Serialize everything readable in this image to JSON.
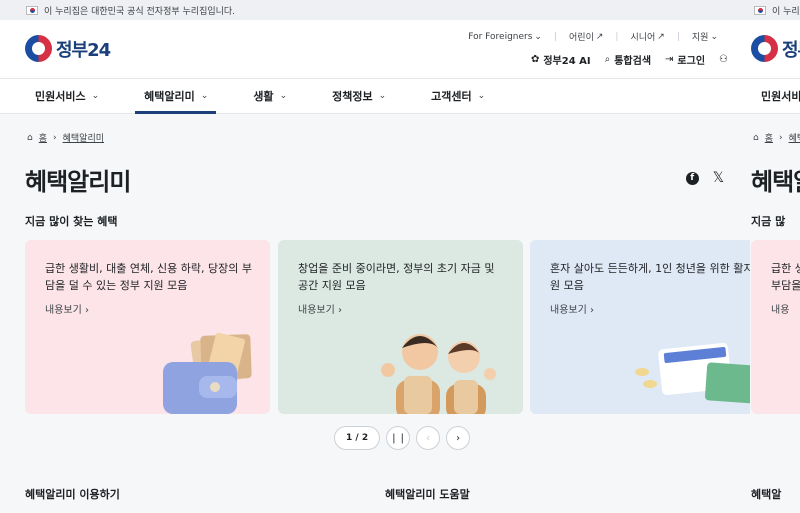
{
  "gov_banner": {
    "text": "이 누리집은 대한민국 공식 전자정부 누리집입니다."
  },
  "logo": {
    "text": "정부24"
  },
  "util_links": [
    "For Foreigners",
    "어린이",
    "시니어",
    "지원"
  ],
  "actions": {
    "ai": "정부24 AI",
    "search": "통합검색",
    "login": "로그인"
  },
  "nav": [
    "민원서비스",
    "혜택알리미",
    "생활",
    "정책정보",
    "고객센터"
  ],
  "breadcrumb": {
    "home": "홈",
    "current": "혜택알리미"
  },
  "page_title": "혜택알리미",
  "section_title": "지금 많이 찾는 혜택",
  "cards": [
    {
      "text": "급한 생활비, 대출 연체, 신용 하락, 당장의 부담을 덜 수 있는 정부 지원 모음",
      "more": "내용보기"
    },
    {
      "text": "창업을 준비 중이라면, 정부의 초기 자금 및 공간 지원 모음",
      "more": "내용보기"
    },
    {
      "text": "혼자 살아도 든든하게, 1인 청년을 위한 활지원 모음",
      "more": "내용보기"
    }
  ],
  "pager": {
    "count": "1 / 2"
  },
  "footer_links": [
    "혜택알리미 이용하기",
    "혜택알리미 도움말"
  ],
  "second_copy": {
    "nav_first": "민원서비",
    "page_title": "혜택알",
    "section_title": "지금 많",
    "card_text": "급한 생",
    "card_text2": "부담을",
    "card_more": "내용",
    "footer": "혜택알"
  },
  "colors": {
    "brand": "#1b3f7a",
    "card1": "#fce4e8",
    "card2": "#dce8e2",
    "card3": "#dfe8f5"
  }
}
